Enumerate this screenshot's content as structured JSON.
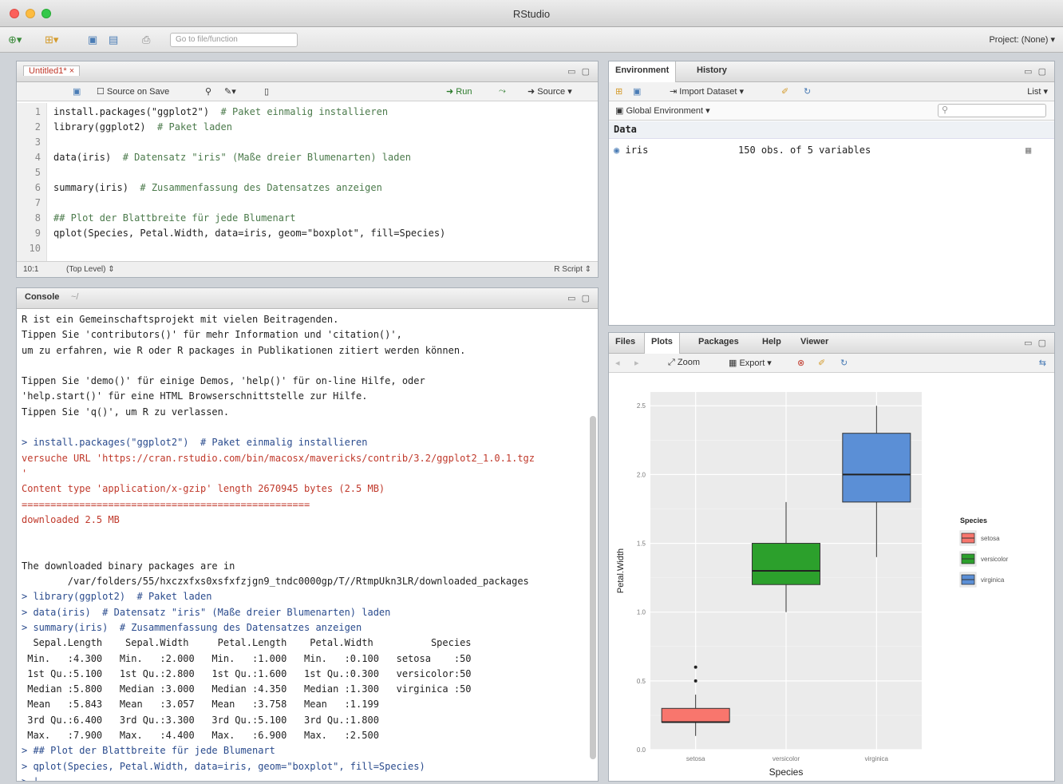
{
  "window": {
    "title": "RStudio"
  },
  "toolbar": {
    "goto_placeholder": "Go to file/function",
    "project_label": "Project: (None) ▾"
  },
  "source": {
    "tab_label": "Untitled1* ×",
    "source_on_save": "Source on Save",
    "run_label": "Run",
    "source_label": "Source",
    "lines": [
      {
        "n": "1",
        "code": "install.packages(\"ggplot2\")",
        "comment": "  # Paket einmalig installieren"
      },
      {
        "n": "2",
        "code": "library(ggplot2)",
        "comment": "  # Paket laden"
      },
      {
        "n": "3",
        "code": "",
        "comment": ""
      },
      {
        "n": "4",
        "code": "data(iris)",
        "comment": "  # Datensatz \"iris\" (Maße dreier Blumenarten) laden"
      },
      {
        "n": "5",
        "code": "",
        "comment": ""
      },
      {
        "n": "6",
        "code": "summary(iris)",
        "comment": "  # Zusammenfassung des Datensatzes anzeigen"
      },
      {
        "n": "7",
        "code": "",
        "comment": ""
      },
      {
        "n": "8",
        "code": "",
        "comment": "## Plot der Blattbreite für jede Blumenart"
      },
      {
        "n": "9",
        "code": "qplot(Species, Petal.Width, data=iris, geom=\"boxplot\", fill=Species)",
        "comment": ""
      },
      {
        "n": "10",
        "code": "",
        "comment": ""
      }
    ],
    "status_pos": "10:1",
    "status_level": "(Top Level) ⇕",
    "status_type": "R Script ⇕"
  },
  "console": {
    "tab_label": "Console",
    "path": "~/",
    "lines": [
      {
        "t": "R ist ein Gemeinschaftsprojekt mit vielen Beitragenden.",
        "c": ""
      },
      {
        "t": "Tippen Sie 'contributors()' für mehr Information und 'citation()',",
        "c": ""
      },
      {
        "t": "um zu erfahren, wie R oder R packages in Publikationen zitiert werden können.",
        "c": ""
      },
      {
        "t": "",
        "c": ""
      },
      {
        "t": "Tippen Sie 'demo()' für einige Demos, 'help()' für on-line Hilfe, oder",
        "c": ""
      },
      {
        "t": "'help.start()' für eine HTML Browserschnittstelle zur Hilfe.",
        "c": ""
      },
      {
        "t": "Tippen Sie 'q()', um R zu verlassen.",
        "c": ""
      },
      {
        "t": "",
        "c": ""
      },
      {
        "t": "> install.packages(\"ggplot2\")  # Paket einmalig installieren",
        "c": "blue"
      },
      {
        "t": "versuche URL 'https://cran.rstudio.com/bin/macosx/mavericks/contrib/3.2/ggplot2_1.0.1.tgz",
        "c": "red"
      },
      {
        "t": "'",
        "c": "red"
      },
      {
        "t": "Content type 'application/x-gzip' length 2670945 bytes (2.5 MB)",
        "c": "red"
      },
      {
        "t": "==================================================",
        "c": "red"
      },
      {
        "t": "downloaded 2.5 MB",
        "c": "red"
      },
      {
        "t": "",
        "c": ""
      },
      {
        "t": "",
        "c": ""
      },
      {
        "t": "The downloaded binary packages are in",
        "c": ""
      },
      {
        "t": "        /var/folders/55/hxczxfxs0xsfxfzjgn9_tndc0000gp/T//RtmpUkn3LR/downloaded_packages",
        "c": ""
      },
      {
        "t": "> library(ggplot2)  # Paket laden",
        "c": "blue"
      },
      {
        "t": "> data(iris)  # Datensatz \"iris\" (Maße dreier Blumenarten) laden",
        "c": "blue"
      },
      {
        "t": "> summary(iris)  # Zusammenfassung des Datensatzes anzeigen",
        "c": "blue"
      },
      {
        "t": "  Sepal.Length    Sepal.Width     Petal.Length    Petal.Width          Species  ",
        "c": ""
      },
      {
        "t": " Min.   :4.300   Min.   :2.000   Min.   :1.000   Min.   :0.100   setosa    :50  ",
        "c": ""
      },
      {
        "t": " 1st Qu.:5.100   1st Qu.:2.800   1st Qu.:1.600   1st Qu.:0.300   versicolor:50  ",
        "c": ""
      },
      {
        "t": " Median :5.800   Median :3.000   Median :4.350   Median :1.300   virginica :50  ",
        "c": ""
      },
      {
        "t": " Mean   :5.843   Mean   :3.057   Mean   :3.758   Mean   :1.199                  ",
        "c": ""
      },
      {
        "t": " 3rd Qu.:6.400   3rd Qu.:3.300   3rd Qu.:5.100   3rd Qu.:1.800                  ",
        "c": ""
      },
      {
        "t": " Max.   :7.900   Max.   :4.400   Max.   :6.900   Max.   :2.500                  ",
        "c": ""
      },
      {
        "t": "> ## Plot der Blattbreite für jede Blumenart",
        "c": "blue"
      },
      {
        "t": "> qplot(Species, Petal.Width, data=iris, geom=\"boxplot\", fill=Species)",
        "c": "blue"
      },
      {
        "t": "> |",
        "c": "blue"
      }
    ]
  },
  "environment": {
    "tabs": [
      "Environment",
      "History"
    ],
    "import_label": "Import Dataset ▾",
    "list_label": "List ▾",
    "scope_label": "Global Environment ▾",
    "section": "Data",
    "rows": [
      {
        "name": "iris",
        "value": "150 obs. of 5 variables"
      }
    ]
  },
  "files": {
    "tabs": [
      "Files",
      "Plots",
      "Packages",
      "Help",
      "Viewer"
    ],
    "zoom_label": "Zoom",
    "export_label": "Export ▾"
  },
  "chart_data": {
    "type": "boxplot",
    "xlabel": "Species",
    "ylabel": "Petal.Width",
    "ylim": [
      0,
      2.6
    ],
    "yticks": [
      "0.0",
      "0.5",
      "1.0",
      "1.5",
      "2.0",
      "2.5"
    ],
    "categories": [
      "setosa",
      "versicolor",
      "virginica"
    ],
    "legend_title": "Species",
    "legend_position": "right",
    "colors": [
      "#f8766d",
      "#2ca02c",
      "#5b8fd6"
    ],
    "boxes": [
      {
        "name": "setosa",
        "min": 0.1,
        "q1": 0.2,
        "median": 0.2,
        "q3": 0.3,
        "max": 0.4,
        "outliers": [
          0.5,
          0.6
        ]
      },
      {
        "name": "versicolor",
        "min": 1.0,
        "q1": 1.2,
        "median": 1.3,
        "q3": 1.5,
        "max": 1.8,
        "outliers": []
      },
      {
        "name": "virginica",
        "min": 1.4,
        "q1": 1.8,
        "median": 2.0,
        "q3": 2.3,
        "max": 2.5,
        "outliers": []
      }
    ]
  }
}
